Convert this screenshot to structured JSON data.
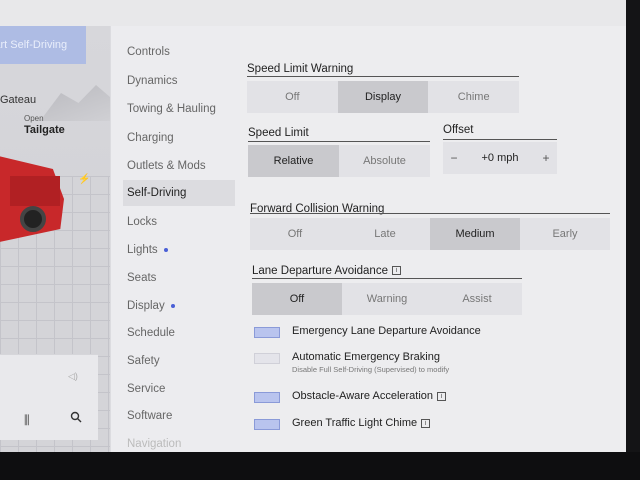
{
  "top_button_label": "Start Self-Driving",
  "vehicle": {
    "name": "Gateau",
    "open_label": "Open",
    "tailgate_label": "Tailgate"
  },
  "nav": {
    "items": [
      {
        "label": "Controls",
        "dot": false
      },
      {
        "label": "Dynamics",
        "dot": false
      },
      {
        "label": "Towing & Hauling",
        "dot": false
      },
      {
        "label": "Charging",
        "dot": false
      },
      {
        "label": "Outlets & Mods",
        "dot": false
      },
      {
        "label": "Self-Driving",
        "dot": false,
        "active": true
      },
      {
        "label": "Locks",
        "dot": false
      },
      {
        "label": "Lights",
        "dot": true
      },
      {
        "label": "Seats",
        "dot": false
      },
      {
        "label": "Display",
        "dot": true
      },
      {
        "label": "Schedule",
        "dot": false
      },
      {
        "label": "Safety",
        "dot": false
      },
      {
        "label": "Service",
        "dot": false
      },
      {
        "label": "Software",
        "dot": false
      },
      {
        "label": "Navigation",
        "dot": false
      }
    ]
  },
  "speed_limit_warning": {
    "title": "Speed Limit Warning",
    "options": [
      "Off",
      "Display",
      "Chime"
    ],
    "selected": "Display"
  },
  "speed_limit": {
    "title": "Speed Limit",
    "options": [
      "Relative",
      "Absolute"
    ],
    "selected": "Relative"
  },
  "offset": {
    "title": "Offset",
    "minus": "−",
    "value": "+0 mph",
    "plus": "+"
  },
  "forward_collision_warning": {
    "title": "Forward Collision Warning",
    "options": [
      "Off",
      "Late",
      "Medium",
      "Early"
    ],
    "selected": "Medium"
  },
  "lane_departure_avoidance": {
    "title": "Lane Departure Avoidance",
    "info": "i",
    "options": [
      "Off",
      "Warning",
      "Assist"
    ],
    "selected": "Off"
  },
  "checkboxes": {
    "emergency_lane": {
      "label": "Emergency Lane Departure Avoidance",
      "checked": true
    },
    "aeb": {
      "label": "Automatic Emergency Braking",
      "sub": "Disable Full Self-Driving (Supervised) to modify",
      "checked": false
    },
    "obstacle": {
      "label": "Obstacle-Aware Acceleration",
      "info": "i",
      "checked": true
    },
    "green_light": {
      "label": "Green Traffic Light Chime",
      "info": "i",
      "checked": true
    }
  },
  "icons": {
    "bolt": "⚡",
    "speaker": "◁)",
    "eq": "⫼"
  },
  "colors": {
    "accent": "#4a5fd6",
    "checkbox_fill": "#b9c4ee",
    "top_button": "#aebce4",
    "truck": "#c8282a"
  }
}
